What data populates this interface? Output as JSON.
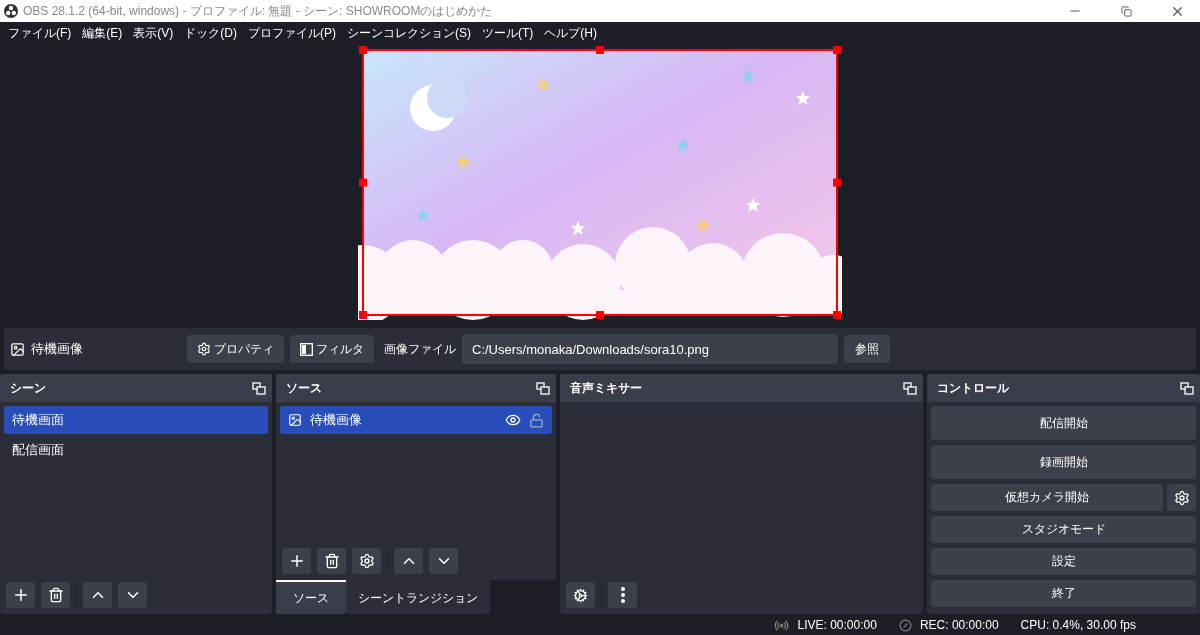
{
  "window": {
    "title": "OBS 28.1.2 (64-bit, windows) - プロファイル: 無題 - シーン: SHOWROOMのはじめかた"
  },
  "menu": [
    "ファイル(F)",
    "編集(E)",
    "表示(V)",
    "ドック(D)",
    "プロファイル(P)",
    "シーンコレクション(S)",
    "ツール(T)",
    "ヘルプ(H)"
  ],
  "properties_bar": {
    "source_name": "待機画像",
    "buttons": [
      {
        "kind": "properties",
        "label": "プロパティ"
      },
      {
        "kind": "filters",
        "label": "フィルタ"
      }
    ],
    "field_label": "画像ファイル",
    "file_path": "C:/Users/monaka/Downloads/sora10.png",
    "browse_button": "参照"
  },
  "scenes": {
    "title": "シーン",
    "items": [
      {
        "label": "待機画面",
        "selected": true
      },
      {
        "label": "配信画面",
        "selected": false
      }
    ]
  },
  "sources": {
    "title": "ソース",
    "items": [
      {
        "label": "待機画像",
        "selected": true,
        "visible": true,
        "locked": false
      }
    ],
    "tabs": [
      {
        "label": "ソース",
        "selected": true
      },
      {
        "label": "シーントランジション",
        "selected": false
      }
    ]
  },
  "mixer": {
    "title": "音声ミキサー"
  },
  "controls": {
    "title": "コントロール",
    "buttons": [
      {
        "label": "配信開始",
        "kind": "plain"
      },
      {
        "label": "録画開始",
        "kind": "plain"
      },
      {
        "label": "仮想カメラ開始",
        "kind": "with_settings"
      },
      {
        "label": "スタジオモード",
        "kind": "plain"
      },
      {
        "label": "設定",
        "kind": "plain"
      },
      {
        "label": "終了",
        "kind": "plain"
      }
    ]
  },
  "status_bar": {
    "live": "LIVE: 00:00:00",
    "rec": "REC: 00:00:00",
    "cpu": "CPU: 0.4%, 30.00 fps"
  }
}
